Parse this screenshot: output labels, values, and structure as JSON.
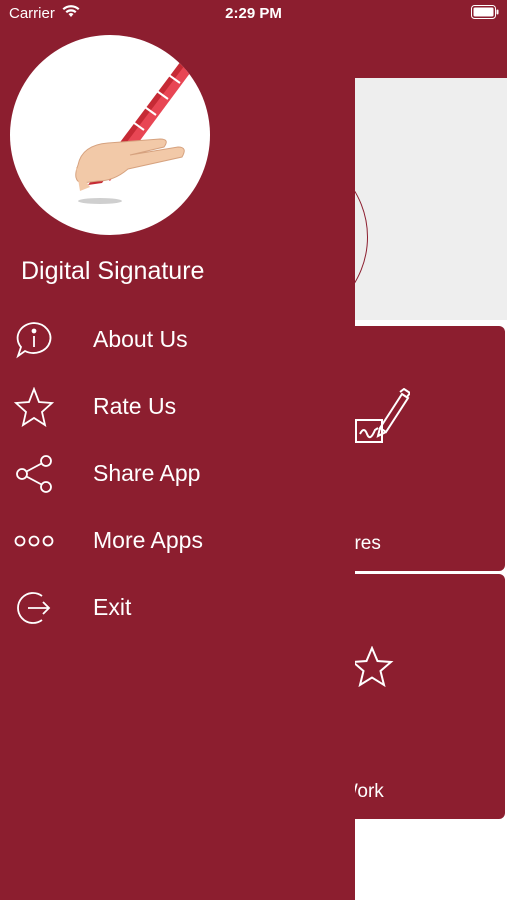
{
  "status": {
    "carrier": "Carrier",
    "time": "2:29 PM"
  },
  "drawer": {
    "title": "Digital Signature",
    "items": [
      {
        "label": "About Us",
        "icon": "info-chat-icon"
      },
      {
        "label": "Rate Us",
        "icon": "star-icon"
      },
      {
        "label": "Share App",
        "icon": "share-icon"
      },
      {
        "label": "More Apps",
        "icon": "more-dots-icon"
      },
      {
        "label": "Exit",
        "icon": "exit-icon"
      }
    ]
  },
  "main": {
    "cards": [
      {
        "label": "e Signatures",
        "icon": "signature-pen-icon"
      },
      {
        "label": "ate Our Work",
        "icon": "star-icon"
      }
    ]
  },
  "colors": {
    "brand": "#8c1e2f",
    "banner": "#eeeeee",
    "text": "#ffffff"
  }
}
